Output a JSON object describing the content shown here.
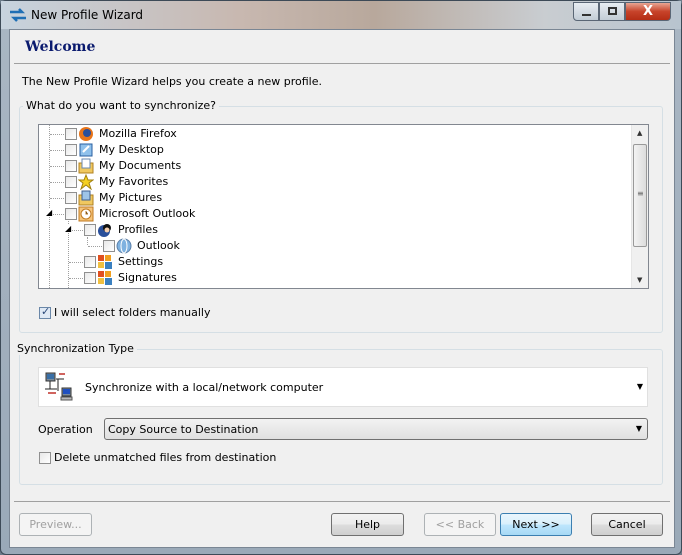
{
  "window": {
    "title": "New Profile Wizard",
    "icon": "sync-arrows-icon"
  },
  "header": {
    "title": "Welcome",
    "title_color": "#0a1a6e"
  },
  "description": "The New Profile Wizard helps you create a new profile.",
  "sync_group": {
    "legend": "What do you want to synchronize?",
    "tree": [
      {
        "label": "Mozilla Firefox",
        "icon": "firefox-icon",
        "checked": false,
        "level": 0
      },
      {
        "label": "My Desktop",
        "icon": "desktop-icon",
        "checked": false,
        "level": 0
      },
      {
        "label": "My Documents",
        "icon": "documents-icon",
        "checked": false,
        "level": 0
      },
      {
        "label": "My Favorites",
        "icon": "star-icon",
        "checked": false,
        "level": 0
      },
      {
        "label": "My Pictures",
        "icon": "pictures-icon",
        "checked": false,
        "level": 0
      },
      {
        "label": "Microsoft Outlook",
        "icon": "outlook-clock-icon",
        "checked": false,
        "level": 0,
        "expanded": true
      },
      {
        "label": "Profiles",
        "icon": "profiles-icon",
        "checked": false,
        "level": 1,
        "expanded": true
      },
      {
        "label": "Outlook",
        "icon": "globe-icon",
        "checked": false,
        "level": 2
      },
      {
        "label": "Settings",
        "icon": "settings-icon",
        "checked": false,
        "level": 1
      },
      {
        "label": "Signatures",
        "icon": "signatures-icon",
        "checked": false,
        "level": 1
      }
    ],
    "manual_checkbox": {
      "label": "I will select folders manually",
      "checked": true
    }
  },
  "sync_type_group": {
    "legend": "Synchronization Type",
    "type_value": "Synchronize with a local/network computer",
    "type_icon": "network-computers-icon",
    "operation_label": "Operation",
    "operation_value": "Copy Source to Destination",
    "delete_checkbox": {
      "label": "Delete unmatched files from destination",
      "checked": false
    }
  },
  "buttons": {
    "preview": "Preview...",
    "help": "Help",
    "back": "<< Back",
    "next": "Next >>",
    "cancel": "Cancel"
  }
}
